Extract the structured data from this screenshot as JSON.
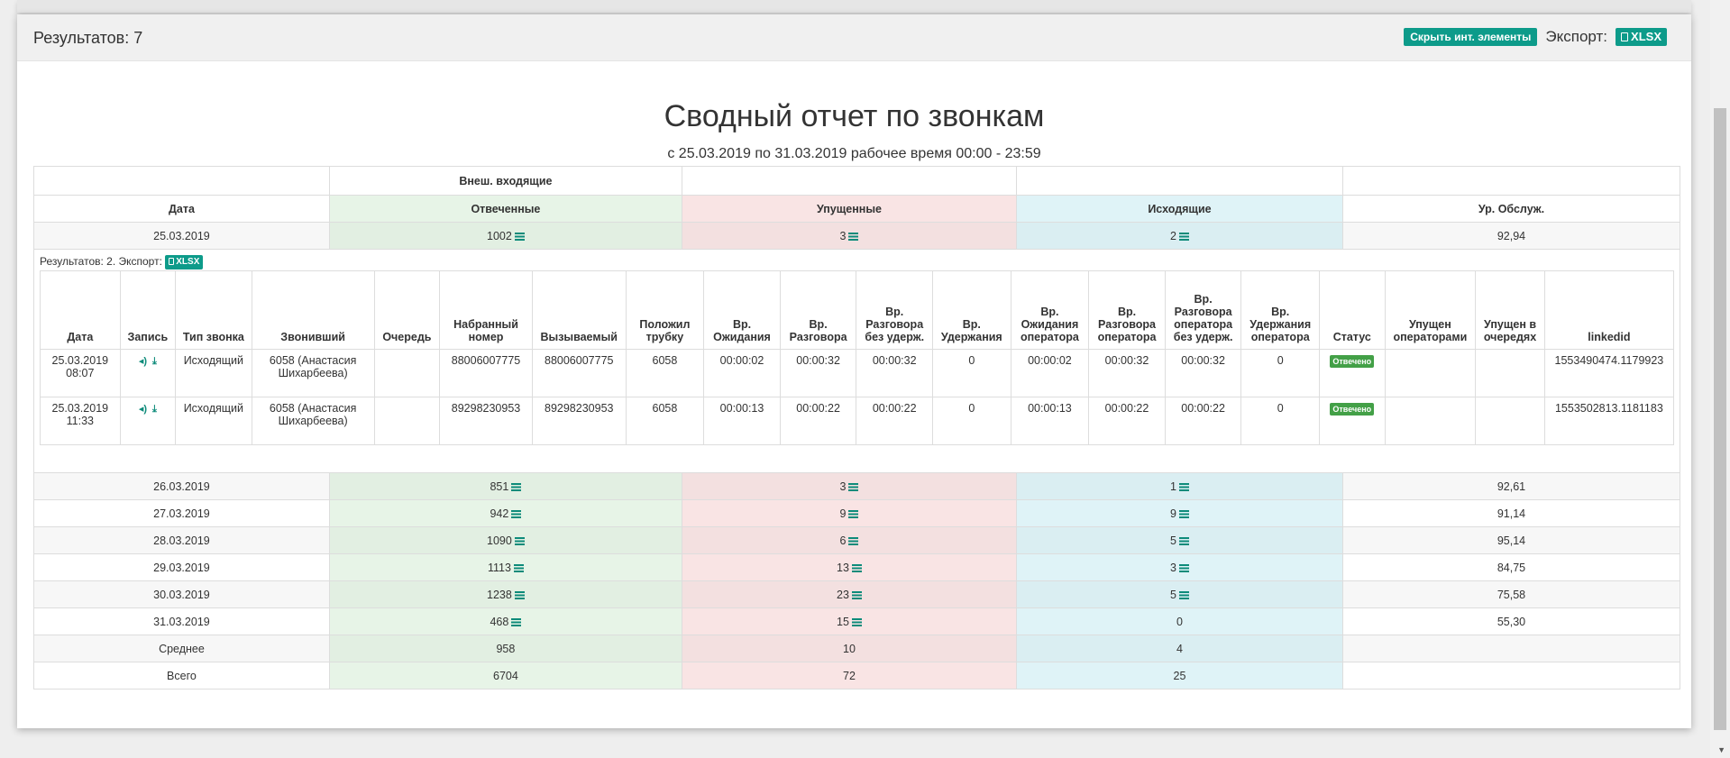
{
  "header": {
    "results_count": "Результатов: 7",
    "hide_button": "Скрыть инт. элементы",
    "export_label": "Экспорт:",
    "xlsx_label": "XLSX"
  },
  "report": {
    "title": "Сводный отчет по звонкам",
    "subtitle": "с 25.03.2019 по 31.03.2019 рабочее время 00:00 - 23:59"
  },
  "summary": {
    "group_header": "Внеш. входящие",
    "columns": [
      "Дата",
      "Отвеченные",
      "Упущенные",
      "Исходящие",
      "Ур. Обслуж."
    ],
    "first_row": [
      "25.03.2019",
      "1002",
      "3",
      "2",
      "92,94"
    ],
    "rows": [
      [
        "26.03.2019",
        "851",
        "3",
        "1",
        "92,61"
      ],
      [
        "27.03.2019",
        "942",
        "9",
        "9",
        "91,14"
      ],
      [
        "28.03.2019",
        "1090",
        "6",
        "5",
        "95,14"
      ],
      [
        "29.03.2019",
        "1113",
        "13",
        "3",
        "84,75"
      ],
      [
        "30.03.2019",
        "1238",
        "23",
        "5",
        "75,58"
      ],
      [
        "31.03.2019",
        "468",
        "15",
        "0",
        "55,30"
      ]
    ],
    "avg_row": [
      "Среднее",
      "958",
      "10",
      "4",
      ""
    ],
    "total_row": [
      "Всего",
      "6704",
      "72",
      "25",
      ""
    ]
  },
  "detail": {
    "results_label": "Результатов: 2. Экспорт:",
    "xlsx_label": "XLSX",
    "columns": [
      "Дата",
      "Запись",
      "Тип звонка",
      "Звонивший",
      "Очередь",
      "Набранный номер",
      "Вызываемый",
      "Положил трубку",
      "Вр. Ожидания",
      "Вр. Разговора",
      "Вр. Разговора без удерж.",
      "Вр. Удержания",
      "Вр. Ожидания оператора",
      "Вр. Разговора оператора",
      "Вр. Разговора оператора без удерж.",
      "Вр. Удержания оператора",
      "Статус",
      "Упущен операторами",
      "Упущен в очередях",
      "linkedid"
    ],
    "rows": [
      {
        "date": "25.03.2019 08:07",
        "type": "Исходящий",
        "caller": "6058 (Анастасия Шихарбеева)",
        "queue": "",
        "dialed": "88006007775",
        "called": "88006007775",
        "hangup": "6058",
        "wait": "00:00:02",
        "talk": "00:00:32",
        "talk_nohold": "00:00:32",
        "hold": "0",
        "op_wait": "00:00:02",
        "op_talk": "00:00:32",
        "op_talk_nohold": "00:00:32",
        "op_hold": "0",
        "status": "Отвечено",
        "missed_ops": "",
        "missed_queues": "",
        "linkedid": "1553490474.1179923"
      },
      {
        "date": "25.03.2019 11:33",
        "type": "Исходящий",
        "caller": "6058 (Анастасия Шихарбеева)",
        "queue": "",
        "dialed": "89298230953",
        "called": "89298230953",
        "hangup": "6058",
        "wait": "00:00:13",
        "talk": "00:00:22",
        "talk_nohold": "00:00:22",
        "hold": "0",
        "op_wait": "00:00:13",
        "op_talk": "00:00:22",
        "op_talk_nohold": "00:00:22",
        "op_hold": "0",
        "status": "Отвечено",
        "missed_ops": "",
        "missed_queues": "",
        "linkedid": "1553502813.1181183"
      }
    ]
  },
  "icons": {
    "list": "list-icon",
    "play": "speaker-icon",
    "download": "download-icon",
    "doc": "file-excel-icon"
  },
  "colors": {
    "accent": "#0d9b8a",
    "answered_bg": "#e7f4e7",
    "missed_bg": "#f9e4e4",
    "outgoing_bg": "#dff3f7",
    "status_ok": "#43a047"
  }
}
